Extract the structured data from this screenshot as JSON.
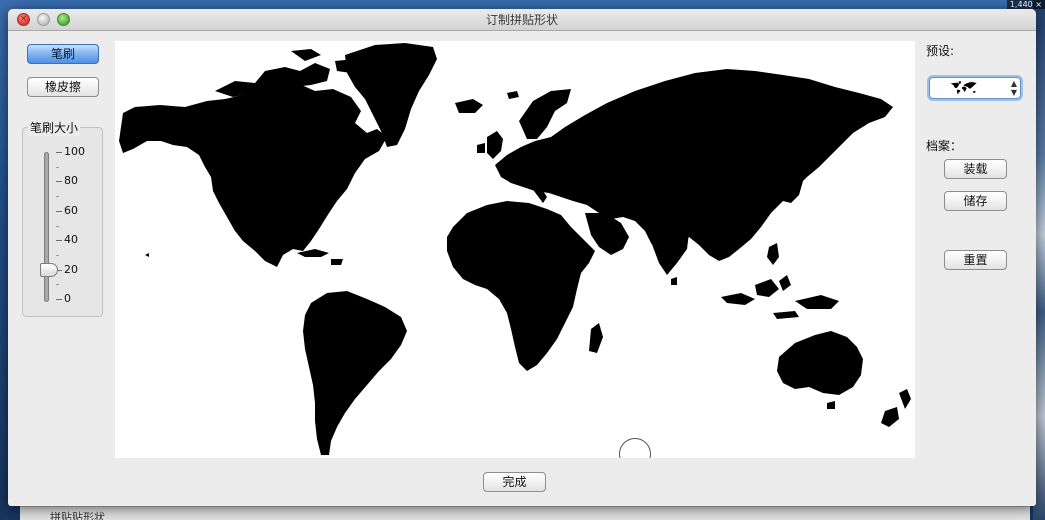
{
  "window": {
    "title": "订制拼贴形状",
    "close_glyph": "×"
  },
  "background": {
    "corner_readout": "1,440 ×",
    "under_window_text": "拼贴贴形状"
  },
  "tools": {
    "brush_label": "笔刷",
    "eraser_label": "橡皮擦",
    "brush_size": {
      "label": "笔刷大小",
      "ticks": [
        "100",
        "80",
        "60",
        "40",
        "20",
        "0"
      ],
      "value": 20
    }
  },
  "right_panel": {
    "preset_label": "预设:",
    "preset_arrows": "▲\n▼",
    "archive_label": "档案：",
    "load_label": "装载",
    "save_label": "储存",
    "reset_label": "重置"
  },
  "footer": {
    "done_label": "完成"
  },
  "colors": {
    "accent": "#4f8fe2",
    "map_fill": "#000000",
    "canvas_bg": "#ffffff"
  }
}
